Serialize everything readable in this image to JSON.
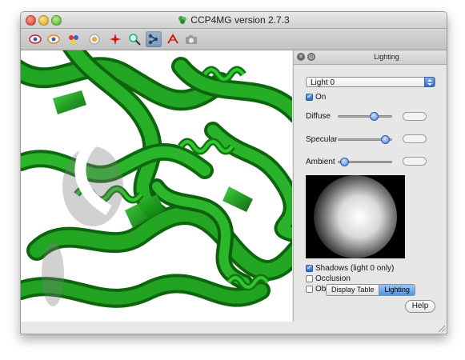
{
  "window": {
    "title": "CCP4MG version 2.7.3"
  },
  "toolbar": {
    "buttons": [
      {
        "icon": "eye-red-icon"
      },
      {
        "icon": "eye-orange-icon"
      },
      {
        "icon": "molecule-color-icon"
      },
      {
        "icon": "target-icon"
      },
      {
        "icon": "star-red-icon"
      },
      {
        "icon": "zoom-icon"
      },
      {
        "icon": "graph-nodes-icon",
        "active": true
      },
      {
        "icon": "measure-icon"
      },
      {
        "icon": "camera-icon"
      }
    ]
  },
  "panel": {
    "title": "Lighting",
    "light_select": {
      "selected": "Light 0"
    },
    "on_label": "On",
    "on_checked": true,
    "sliders": [
      {
        "label": "Diffuse",
        "level": 0.66
      },
      {
        "label": "Specular",
        "level": 0.88
      },
      {
        "label": "Ambient",
        "level": 0.1
      }
    ],
    "options": [
      {
        "label": "Shadows (light 0 only)",
        "checked": true
      },
      {
        "label": "Occlusion",
        "checked": false
      },
      {
        "label": "Object outlines",
        "checked": false
      }
    ],
    "help_label": "Help",
    "tabs": [
      {
        "label": "Display Table",
        "selected": false
      },
      {
        "label": "Lighting",
        "selected": true
      }
    ]
  },
  "colors": {
    "ribbon": "#1f9e1f",
    "accent": "#3f80d8"
  }
}
